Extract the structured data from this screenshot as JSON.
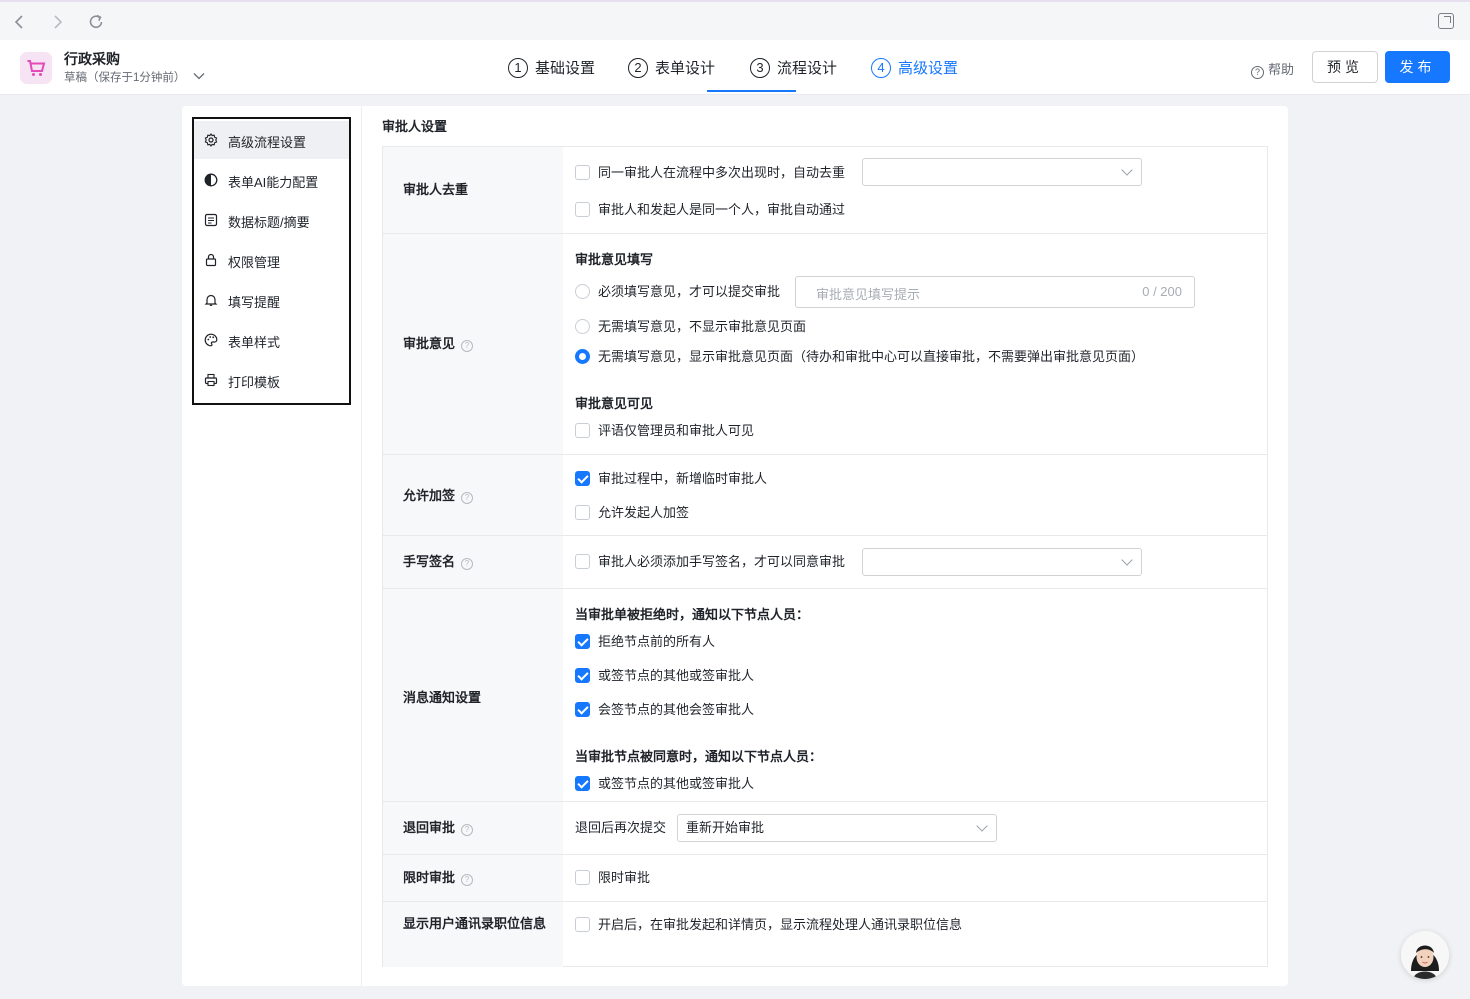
{
  "app": {
    "name": "行政采购",
    "status": "草稿（保存于1分钟前）"
  },
  "steps": [
    {
      "num": "1",
      "label": "基础设置"
    },
    {
      "num": "2",
      "label": "表单设计"
    },
    {
      "num": "3",
      "label": "流程设计"
    },
    {
      "num": "4",
      "label": "高级设置"
    }
  ],
  "header": {
    "help": "帮助",
    "preview": "预览",
    "publish": "发布"
  },
  "sidebar": {
    "items": [
      {
        "label": "高级流程设置",
        "icon": "gear-icon"
      },
      {
        "label": "表单AI能力配置",
        "icon": "ai-icon"
      },
      {
        "label": "数据标题/摘要",
        "icon": "document-icon"
      },
      {
        "label": "权限管理",
        "icon": "lock-icon"
      },
      {
        "label": "填写提醒",
        "icon": "bell-icon"
      },
      {
        "label": "表单样式",
        "icon": "palette-icon"
      },
      {
        "label": "打印模板",
        "icon": "printer-icon"
      }
    ]
  },
  "section": {
    "title": "审批人设置"
  },
  "settings": {
    "dedupe": {
      "label": "审批人去重",
      "opt1": "同一审批人在流程中多次出现时，自动去重",
      "opt2": "审批人和发起人是同一个人，审批自动通过"
    },
    "opinion": {
      "label": "审批意见",
      "fill_title": "审批意见填写",
      "radio1": "必须填写意见，才可以提交审批",
      "placeholder": "审批意见填写提示",
      "counter": "0 / 200",
      "radio2": "无需填写意见，不显示审批意见页面",
      "radio3": "无需填写意见，显示审批意见页面（待办和审批中心可以直接审批，不需要弹出审批意见页面）",
      "visible_title": "审批意见可见",
      "visible_opt": "评语仅管理员和审批人可见"
    },
    "add_sign": {
      "label": "允许加签",
      "opt1": "审批过程中，新增临时审批人",
      "opt2": "允许发起人加签"
    },
    "signature": {
      "label": "手写签名",
      "opt1": "审批人必须添加手写签名，才可以同意审批"
    },
    "notify": {
      "label": "消息通知设置",
      "reject_title": "当审批单被拒绝时，通知以下节点人员：",
      "reject_opt1": "拒绝节点前的所有人",
      "reject_opt2": "或签节点的其他或签审批人",
      "reject_opt3": "会签节点的其他会签审批人",
      "agree_title": "当审批节点被同意时，通知以下节点人员：",
      "agree_opt1": "或签节点的其他或签审批人"
    },
    "return": {
      "label": "退回审批",
      "prefix": "退回后再次提交",
      "value": "重新开始审批"
    },
    "time_limit": {
      "label": "限时审批",
      "opt1": "限时审批"
    },
    "job_info": {
      "label": "显示用户通讯录职位信息",
      "opt1": "开启后，在审批发起和详情页，显示流程处理人通讯录职位信息"
    }
  },
  "colors": {
    "accent": "#1677ff",
    "app_logo_bg": "#f6e3f4",
    "app_logo_icon": "#e24bb8"
  }
}
